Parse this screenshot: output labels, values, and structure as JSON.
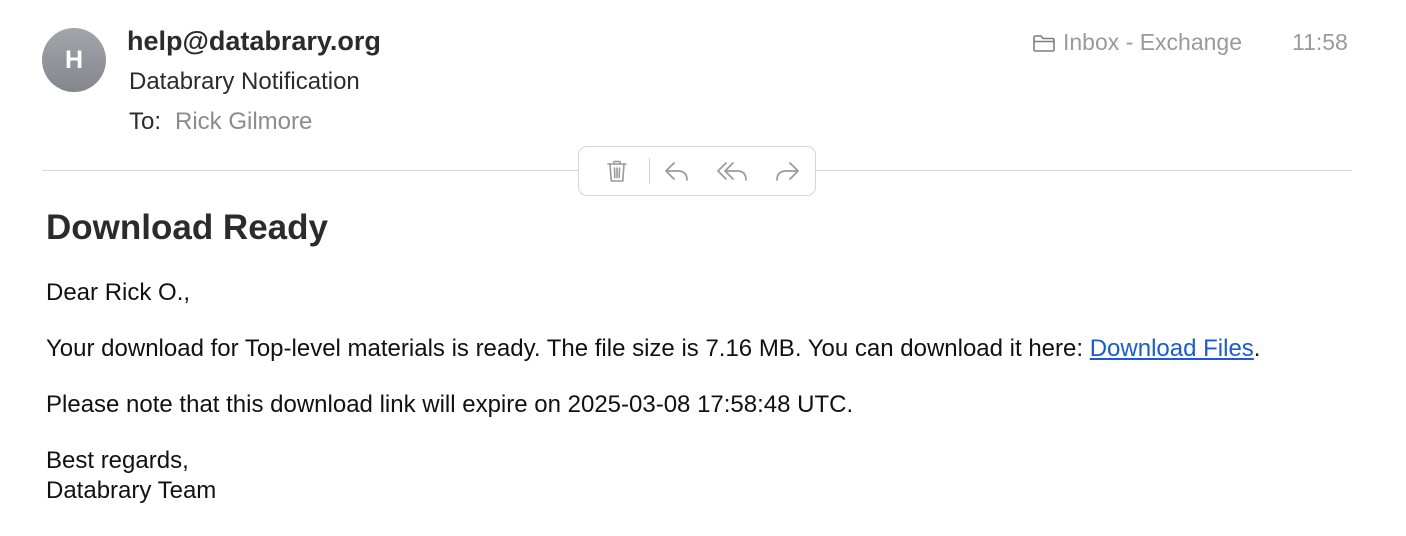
{
  "header": {
    "avatar_initial": "H",
    "sender": "help@databrary.org",
    "subject": "Databrary Notification",
    "to_label": "To:",
    "to_name": "Rick Gilmore",
    "mailbox": "Inbox - Exchange",
    "time": "11:58"
  },
  "toolbar": {
    "buttons": [
      "trash-icon",
      "reply-icon",
      "reply-all-icon",
      "forward-icon"
    ]
  },
  "body": {
    "heading": "Download Ready",
    "greeting": "Dear Rick O.,",
    "main_text": "Your download for Top-level materials is ready. The file size is 7.16 MB. You can download it here: ",
    "link_text": "Download Files",
    "main_end": ".",
    "note": "Please note that this download link will expire on 2025-03-08 17:58:48 UTC.",
    "signoff": "Best regards,",
    "signature": "Databrary Team"
  },
  "colors": {
    "link": "#1a5bd1",
    "muted": "#9a9a9a",
    "avatar": "#8f9096"
  }
}
